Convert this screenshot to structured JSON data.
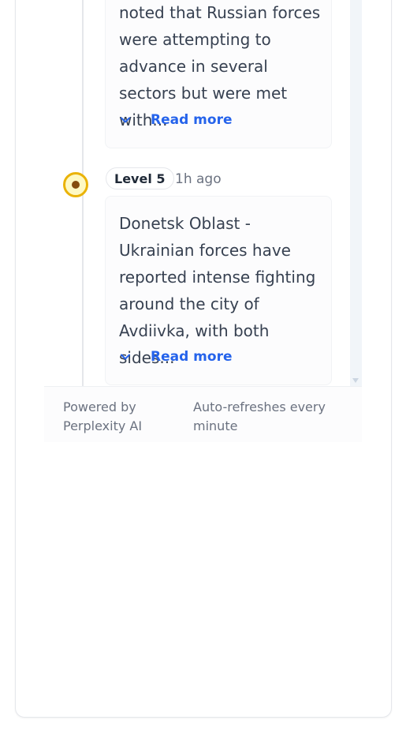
{
  "timeline": {
    "entries": [
      {
        "text": "noted that Russian forces were attempting to advance in several sectors but were met with...",
        "read_more_label": "Read more"
      },
      {
        "level_label": "Level 5",
        "time_ago": "1h ago",
        "text": "Donetsk Oblast - Ukrainian forces have reported intense fighting around the city of Avdiivka, with both sides...",
        "read_more_label": "Read more",
        "level_color": "#eab308"
      }
    ]
  },
  "footer": {
    "powered_by": "Powered by Perplexity AI",
    "refresh_note": "Auto-refreshes every minute"
  },
  "colors": {
    "link": "#2563eb",
    "level5": "#eab308"
  }
}
